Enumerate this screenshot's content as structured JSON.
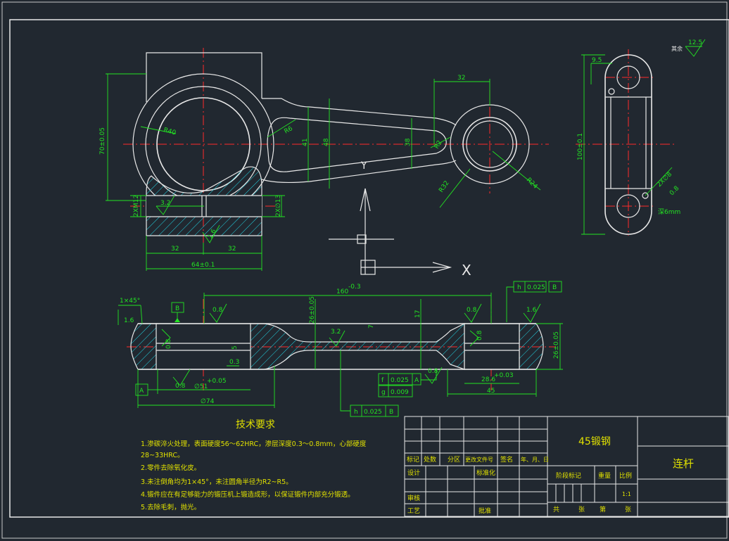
{
  "drawing": {
    "part_name": "连杆",
    "material": "45锻钢",
    "surface_roughness_other": {
      "label": "其余",
      "value": "12.5"
    },
    "tech_requirements_title": "技术要求",
    "tech_requirements": [
      "1.渗碳淬火处理，表面硬度56～62HRC，渗层深度0.3～0.8mm，心部硬度",
      "28~33HRC。",
      "2.零件去除氧化皮。",
      "3.未注倒角均为1×45°，未注圆角半径为R2~R5。",
      "4.锻件应在有足够能力的锻压机上锻造成形，以保证锻件内部充分锻透。",
      "5.去除毛刺，抛光。"
    ],
    "title_block": {
      "row_labels": [
        "标记",
        "处数",
        "分区",
        "更改文件号",
        "签名",
        "年、月、日"
      ],
      "design": "设计",
      "standardize": "标准化",
      "review": "审核",
      "process": "工艺",
      "approve": "批准",
      "stage_mark": "阶段标记",
      "weight": "重量",
      "scale_label": "比例",
      "scale_value": "1:1",
      "sheets_total": "共",
      "sheets_unit1": "张",
      "sheet_no": "第",
      "sheets_unit2": "张"
    },
    "dimensions": {
      "top_view": {
        "d32_top": "32",
        "r40": "R40",
        "d70": "70±0.05",
        "r86": "R6",
        "d41": "41",
        "d48": "48",
        "d38": "38",
        "r42": "R2",
        "r32": "R32",
        "r24": "R24",
        "m12": "2XM12",
        "roughness32": "3.2",
        "d2x13": "2X∅13",
        "d1_6": "1.6",
        "d32_left": "32",
        "d32_right": "32",
        "d64": "64±0.1",
        "y_axis": "Y",
        "x_axis": "X"
      },
      "side_view": {
        "d9_5": "9.5",
        "roughness125": "12.5",
        "d100": "100±0.1",
        "d2xphi8": "2X∅8",
        "roughness08": "0.8",
        "depth": "深6mm"
      },
      "section_view": {
        "chamfer": "1×45°",
        "r16": "1.6",
        "datum_b": "B",
        "datum_a": "A",
        "d160": "160",
        "d160_tol": "-0.3",
        "d26_left": "26±0.05",
        "d17": "17",
        "d7": "7",
        "d5": "5",
        "d0_3": "0.3",
        "r08_a": "0.8",
        "r08_b": "0.8",
        "r08_c": "0.8",
        "r08_d": "0.8",
        "r08_e": "0.8",
        "r08_f": "0.8",
        "r32_s": "3.2",
        "r16_r": "1.6",
        "phi51": "∅51",
        "phi51_tol": "+0.05",
        "phi74": "∅74",
        "d28_6": "28.6",
        "d28_tol": "+0.03",
        "d45": "45",
        "d26_right": "26±0.05",
        "fcf_top": {
          "sym": "h",
          "val": "0.025",
          "datum": "B"
        },
        "fcf_f": {
          "sym": "f",
          "val": "0.025",
          "datum": "A"
        },
        "fcf_g": {
          "sym": "g",
          "val": "0.009"
        },
        "fcf_bottom": {
          "sym": "h",
          "val": "0.025",
          "datum": "B"
        }
      }
    }
  }
}
